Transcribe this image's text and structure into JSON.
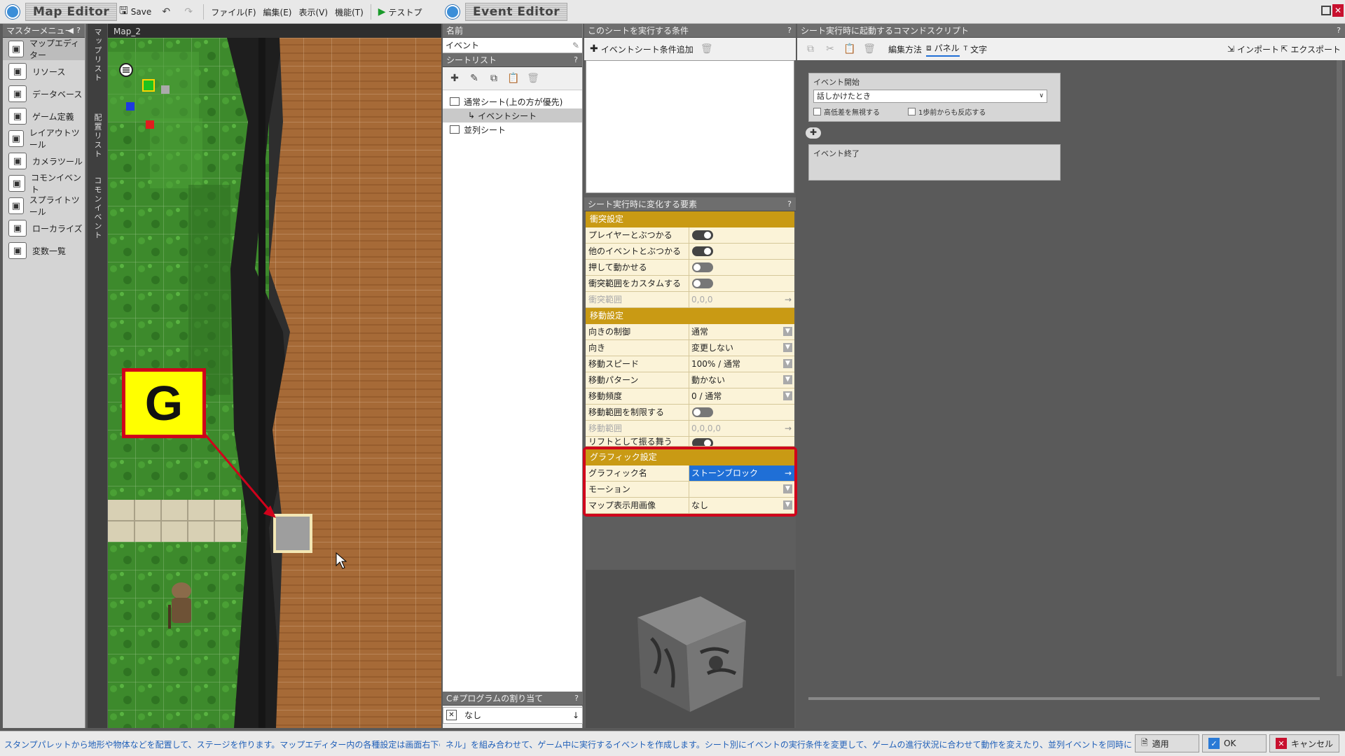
{
  "map_editor": {
    "title": "Map Editor",
    "toolbar": {
      "save_label": "Save",
      "menus": [
        "ファイル(F)",
        "編集(E)",
        "表示(V)",
        "機能(T)"
      ],
      "test_play_label": "テストプ"
    },
    "master_menu": {
      "title": "マスターメニュー",
      "items": [
        {
          "label": "マップエディター",
          "icon": "map-icon"
        },
        {
          "label": "リソース",
          "icon": "resource-icon"
        },
        {
          "label": "データベース",
          "icon": "database-icon"
        },
        {
          "label": "ゲーム定義",
          "icon": "game-definition-icon"
        },
        {
          "label": "レイアウトツール",
          "icon": "layout-icon"
        },
        {
          "label": "カメラツール",
          "icon": "camera-icon"
        },
        {
          "label": "コモンイベント",
          "icon": "common-event-icon"
        },
        {
          "label": "スプライトツール",
          "icon": "sprite-icon"
        },
        {
          "label": "ローカライズ",
          "icon": "globe-icon"
        },
        {
          "label": "変数一覧",
          "icon": "variables-icon"
        }
      ]
    },
    "side_tabs": [
      "マップリスト",
      "配置リスト",
      "コモンイベント"
    ],
    "map_tab_label": "Map_2",
    "callout_letter": "G",
    "status_text": "スタンプパレットから地形や物体などを配置して、ステージを作ります。マップエディター内の各種設定は画面右下のボタンや、"
  },
  "event_editor": {
    "title": "Event Editor",
    "name_panel": {
      "header": "名前",
      "value": "イベント"
    },
    "sheet_list": {
      "header": "シートリスト",
      "items": [
        {
          "label": "通常シート(上の方が優先)"
        },
        {
          "label": "イベントシート"
        },
        {
          "label": "並列シート"
        }
      ]
    },
    "csharp": {
      "header": "C#プログラムの割り当て",
      "value": "なし"
    },
    "conditions": {
      "header": "このシートを実行する条件",
      "add_label": "イベントシート条件追加"
    },
    "properties": {
      "header": "シート実行時に変化する要素",
      "collision_section": "衝突設定",
      "collision": [
        {
          "label": "プレイヤーとぶつかる",
          "on": true
        },
        {
          "label": "他のイベントとぶつかる",
          "on": true
        },
        {
          "label": "押して動かせる",
          "on": false
        },
        {
          "label": "衝突範囲をカスタムする",
          "on": false
        }
      ],
      "collision_range": {
        "label": "衝突範囲",
        "value": "0,0,0"
      },
      "movement_section": "移動設定",
      "movement": [
        {
          "label": "向きの制御",
          "value": "通常"
        },
        {
          "label": "向き",
          "value": "変更しない"
        },
        {
          "label": "移動スピード",
          "value": "100% / 通常"
        },
        {
          "label": "移動パターン",
          "value": "動かない"
        },
        {
          "label": "移動頻度",
          "value": "0 / 通常"
        }
      ],
      "limit_move": {
        "label": "移動範囲を制限する"
      },
      "move_range": {
        "label": "移動範囲",
        "value": "0,0,0,0"
      },
      "lift": {
        "label": "リフトとして振る舞う"
      },
      "graphic_section": "グラフィック設定",
      "graphic": [
        {
          "label": "グラフィック名",
          "value": "ストーンブロック"
        },
        {
          "label": "モーション",
          "value": ""
        },
        {
          "label": "マップ表示用画像",
          "value": "なし"
        }
      ]
    },
    "script": {
      "header": "シート実行時に起動するコマンドスクリプト",
      "edit_method_label": "編集方法",
      "panel_label": "パネル",
      "text_label": "文字",
      "import_label": "インポート",
      "export_label": "エクスポート",
      "start_label": "イベント開始",
      "trigger_value": "話しかけたとき",
      "ignore_height_label": "高低差を無視する",
      "one_step_label": "1歩前からも反応する",
      "end_label": "イベント終了"
    },
    "status_text": "ネル」を組み合わせて、ゲーム中に実行するイベントを作成します。シート別にイベントの実行条件を変更して、ゲームの進行状況に合わせて動作を変えたり、並列イベントを同時に実行させるこ",
    "buttons": {
      "apply": "適用",
      "ok": "OK",
      "cancel": "キャンセル"
    }
  },
  "colors": {
    "section_gold": "#c99a14",
    "highlight_red": "#d0021b",
    "selection_blue": "#1f6fd6",
    "callout_yellow": "#ffff00"
  }
}
